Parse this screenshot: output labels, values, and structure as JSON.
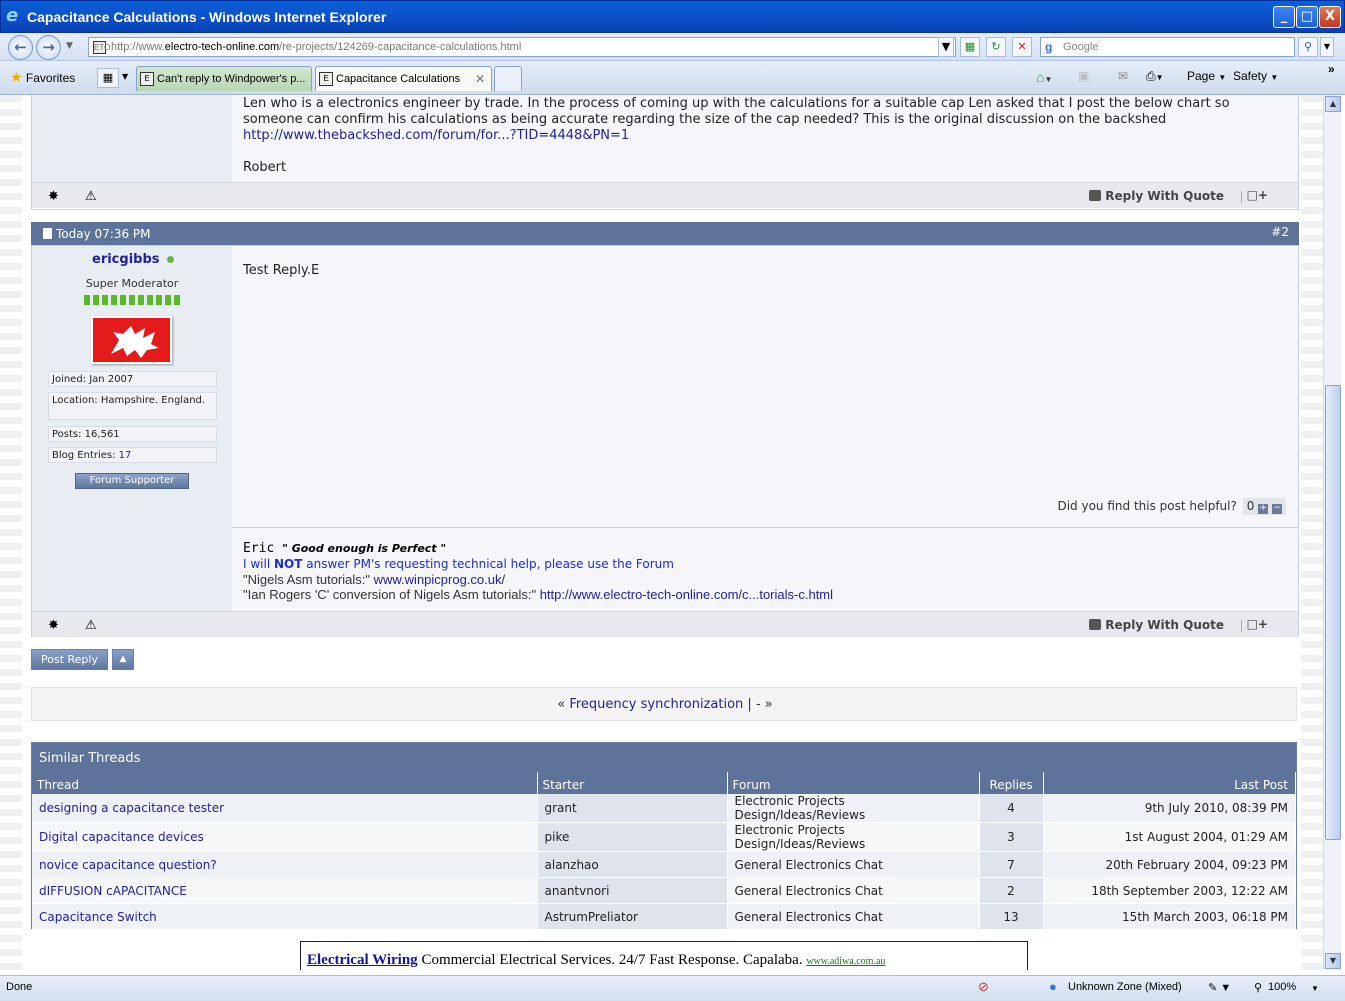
{
  "window": {
    "title": "Capacitance Calculations - Windows Internet Explorer",
    "controls": [
      "_",
      "□",
      "X"
    ]
  },
  "address": {
    "url_prefix": "http://www.",
    "url_domain": "electro-tech-online.com",
    "url_path": "/re-projects/124269-capacitance-calculations.html",
    "search_placeholder": "Google"
  },
  "tabs": {
    "favorites_label": "Favorites",
    "items": [
      {
        "label": "Can't reply to Windpower's p...",
        "active": false
      },
      {
        "label": "Capacitance Calculations",
        "active": true
      }
    ],
    "commands": {
      "page": "Page",
      "safety": "Safety"
    }
  },
  "post1": {
    "line1": "Len who is a electronics engineer by trade. In the process of coming up with the calculations for a suitable cap Len asked that I post the below chart so",
    "line2": "someone can confirm his calculations as being accurate regarding the size of the cap needed? This is the original discussion on the backshed",
    "link": "http://www.thebackshed.com/forum/for...?TID=4448&PN=1",
    "signoff": "Robert",
    "reply_with_quote": "Reply With Quote"
  },
  "post2": {
    "date": "Today 07:36 PM",
    "number": "#2",
    "username": "ericgibbs",
    "usertitle": "Super Moderator",
    "joined": "Joined: Jan 2007",
    "location": "Location: Hampshire. England.",
    "posts": "Posts: 16,561",
    "blog_label": "Blog Entries: ",
    "blog_count": "17",
    "supporter_badge": "Forum Supporter",
    "body": "Test Reply.E",
    "helpful_question": "Did you find this post helpful?",
    "helpful_count": "0",
    "sig_name": "Eric",
    "sig_motto": "\" Good enough is Perfect \"",
    "sig_line2_a": "I will ",
    "sig_line2_not": "NOT",
    "sig_line2_b": " answer PM's requesting technical help, please use the Forum",
    "sig_line3_label": "\"Nigels Asm tutorials:\" ",
    "sig_line3_link": "www.winpicprog.co.uk/",
    "sig_line4_label": "\"Ian Rogers 'C' conversion of Nigels Asm tutorials:\" ",
    "sig_line4_link": "http://www.electro-tech-online.com/c...torials-c.html",
    "reply_with_quote": "Reply With Quote"
  },
  "actions": {
    "post_reply": "Post Reply",
    "up_arrow": "▲"
  },
  "thread_nav": {
    "prev_arrow": "«",
    "prev_title": "Frequency synchronization",
    "divider": "|",
    "dash": "-",
    "next_arrow": "»"
  },
  "similar": {
    "heading": "Similar Threads",
    "columns": [
      "Thread",
      "Starter",
      "Forum",
      "Replies",
      "Last Post"
    ],
    "rows": [
      {
        "thread": "designing a capacitance tester",
        "starter": "grant",
        "forum": "Electronic Projects Design/Ideas/Reviews",
        "replies": "4",
        "last": "9th July 2010, 08:39 PM"
      },
      {
        "thread": "Digital capacitance devices",
        "starter": "pike",
        "forum": "Electronic Projects Design/Ideas/Reviews",
        "replies": "3",
        "last": "1st August 2004, 01:29 AM"
      },
      {
        "thread": "novice capacitance question?",
        "starter": "alanzhao",
        "forum": "General Electronics Chat",
        "replies": "7",
        "last": "20th February 2004, 09:23 PM"
      },
      {
        "thread": "dIFFUSION cAPACITANCE",
        "starter": "anantvnori",
        "forum": "General Electronics Chat",
        "replies": "2",
        "last": "18th September 2003, 12:22 AM"
      },
      {
        "thread": "Capacitance Switch",
        "starter": "AstrumPreliator",
        "forum": "General Electronics Chat",
        "replies": "13",
        "last": "15th March 2003, 06:18 PM"
      }
    ]
  },
  "ad": {
    "keyword": "Electrical Wiring",
    "text": " Commercial Electrical Services. 24/7 Fast Response. Capalaba. ",
    "url": "www.adiwa.com.au"
  },
  "statusbar": {
    "left": "Done",
    "zone": "Unknown Zone (Mixed)",
    "zoom": "100%"
  },
  "colors": {
    "post_header": "#5d7399",
    "link": "#22229c",
    "online_dot": "#6ab04c"
  }
}
